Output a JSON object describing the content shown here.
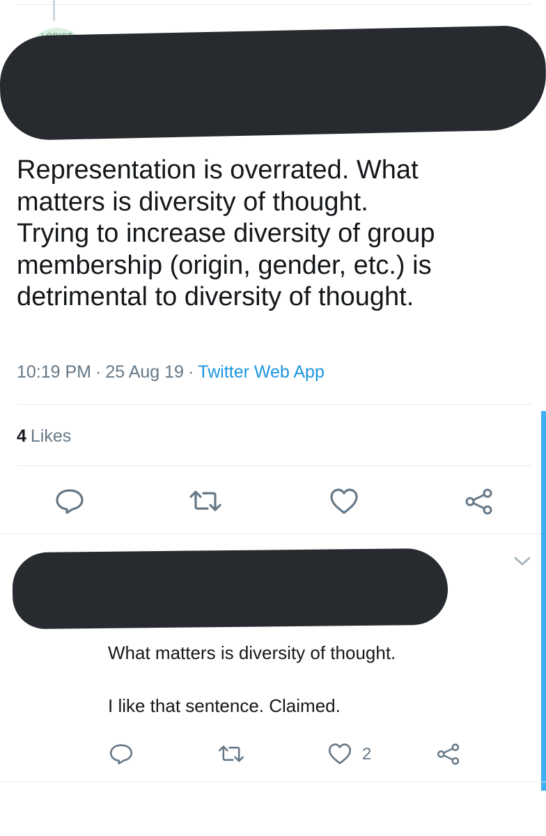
{
  "main_tweet": {
    "avatar_text": "LOBIST",
    "text": "Representation is overrated. What\nmatters is diversity of thought.\nTrying to increase diversity of group\nmembership (origin, gender, etc.) is\ndetrimental to diversity of thought.",
    "time": "10:19 PM",
    "date": "25 Aug 19",
    "separator": "·",
    "source": "Twitter Web App",
    "likes_count": "4",
    "likes_label": "Likes"
  },
  "reply_tweet": {
    "text": "What matters is diversity of thought.\n\nI like that sentence. Claimed.",
    "like_count": "2"
  },
  "icons": {
    "reply": "reply-icon",
    "retweet": "retweet-icon",
    "like": "heart-icon",
    "share": "share-icon",
    "chevron": "chevron-down-icon"
  },
  "colors": {
    "text": "#14171a",
    "secondary": "#657786",
    "link": "#1b95e0",
    "redaction": "#272b30",
    "divider": "#e6ecf0"
  }
}
